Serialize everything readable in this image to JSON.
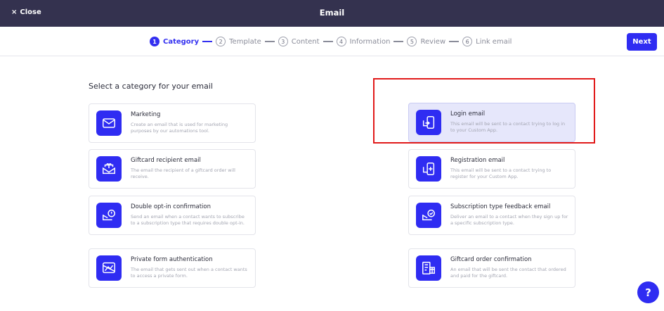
{
  "header": {
    "close_label": "Close",
    "close_icon": "×",
    "title": "Email"
  },
  "steps": [
    {
      "num": "1",
      "label": "Category"
    },
    {
      "num": "2",
      "label": "Template"
    },
    {
      "num": "3",
      "label": "Content"
    },
    {
      "num": "4",
      "label": "Information"
    },
    {
      "num": "5",
      "label": "Review"
    },
    {
      "num": "6",
      "label": "Link email"
    }
  ],
  "next_label": "Next",
  "heading": "Select a category for your email",
  "categories": {
    "marketing": {
      "title": "Marketing",
      "desc": "Create an email that is used for marketing purposes by our automations tool."
    },
    "giftcard_recipient": {
      "title": "Giftcard recipient email",
      "desc": "The email the recipient of a giftcard order will receive."
    },
    "double_optin": {
      "title": "Double opt-in confirmation",
      "desc": "Send an email when a contact wants to subscribe to a subscription type that requires double opt-in."
    },
    "private_form": {
      "title": "Private form authentication",
      "desc": "The email that gets sent out when a contact wants to access a private form."
    },
    "login": {
      "title": "Login email",
      "desc": "This email will be sent to a contact trying to log in to your Custom App."
    },
    "registration": {
      "title": "Registration email",
      "desc": "This email will be sent to a contact trying to register for your Custom App."
    },
    "subscription_feedback": {
      "title": "Subscription type feedback email",
      "desc": "Deliver an email to a contact when they sign up for a specific subscription type."
    },
    "giftcard_order": {
      "title": "Giftcard order confirmation",
      "desc": "An email that will be sent the contact that ordered and paid for the giftcard."
    }
  },
  "help_label": "?",
  "colors": {
    "accent": "#2f2cf2",
    "topbar": "#34324f",
    "highlight": "#e11a1a",
    "selected_card": "#e6e7fb"
  }
}
